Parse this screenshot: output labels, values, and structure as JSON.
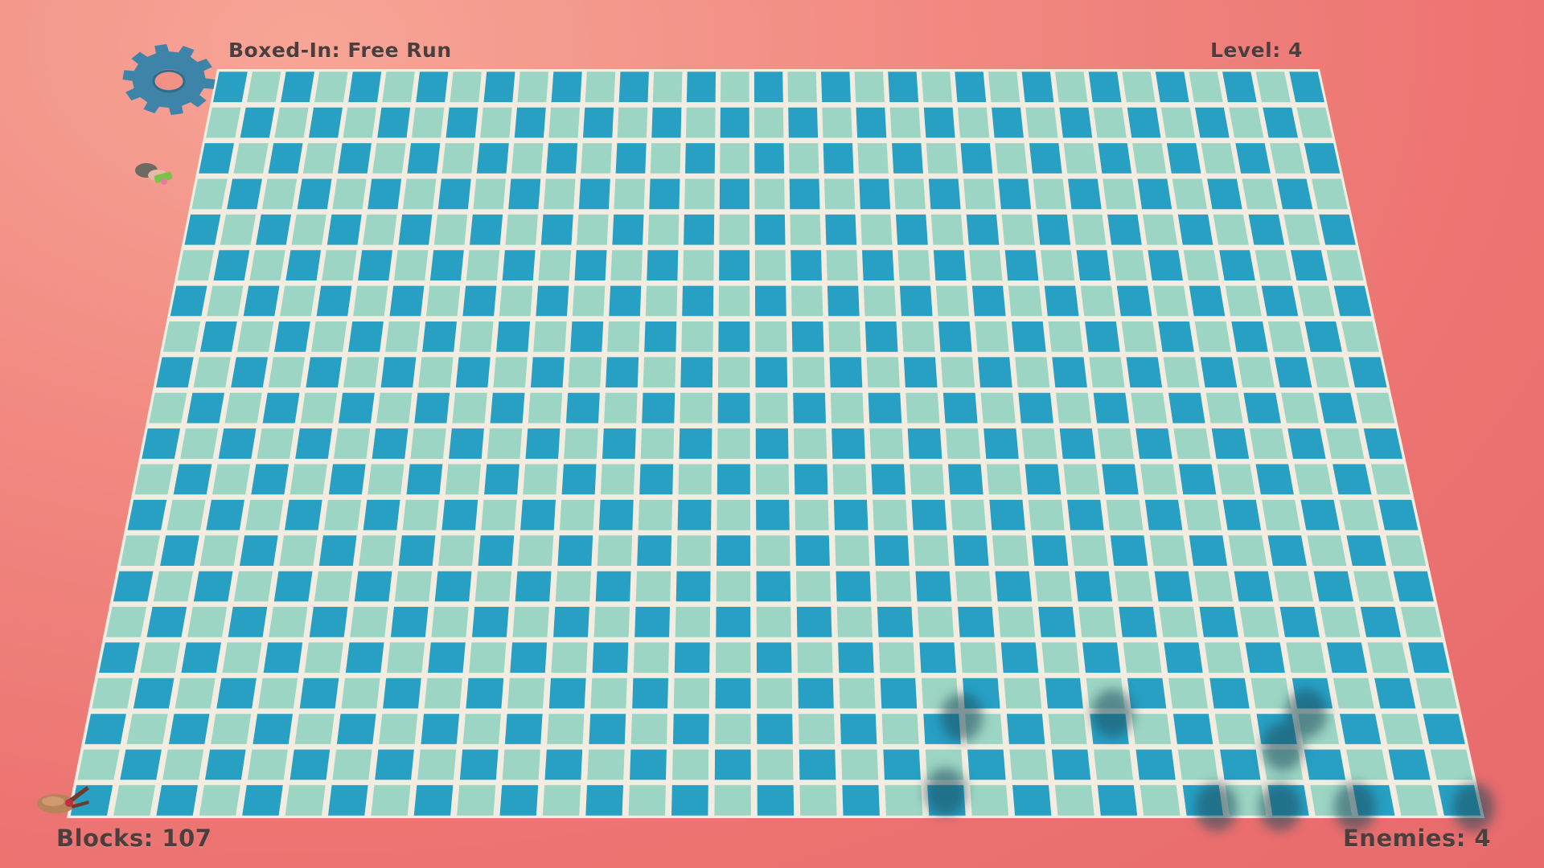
{
  "game": {
    "title": "Boxed-In: Free Run",
    "level_label": "Level:",
    "level_value": "4",
    "blocks_label": "Blocks:",
    "blocks_value": "107",
    "enemies_label": "Enemies:",
    "enemies_value": "4"
  },
  "icons": {
    "settings": "gear-icon",
    "player": "player-character",
    "enemy_indicator": "enemy-character"
  },
  "colors": {
    "background": "#ec7371",
    "tile_dark": "#27a0c4",
    "tile_light": "#9dd5c4",
    "grout": "#f2ede0",
    "gear": "#3d84a8",
    "hud_text": "#4d3e3e",
    "shadow": "#1e4c5c"
  }
}
